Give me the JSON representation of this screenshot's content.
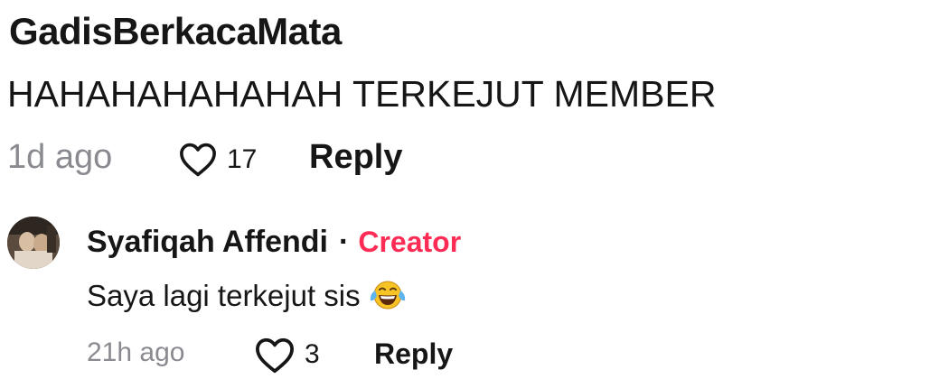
{
  "comment": {
    "username": "GadisBerkacaMata",
    "text": "HAHAHAHAHAHAH TERKEJUT MEMBER",
    "time": "1d ago",
    "likes": "17",
    "reply_label": "Reply",
    "like_icon": "heart-outline-icon"
  },
  "reply": {
    "username": "Syafiqah Affendi",
    "separator": "·",
    "badge": "Creator",
    "badge_color": "#fe2c55",
    "text": "Saya lagi terkejut sis",
    "emoji_icon": "face-with-tears-of-joy-emoji",
    "time": "21h ago",
    "likes": "3",
    "reply_label": "Reply",
    "like_icon": "heart-outline-icon",
    "avatar": "user-avatar"
  }
}
